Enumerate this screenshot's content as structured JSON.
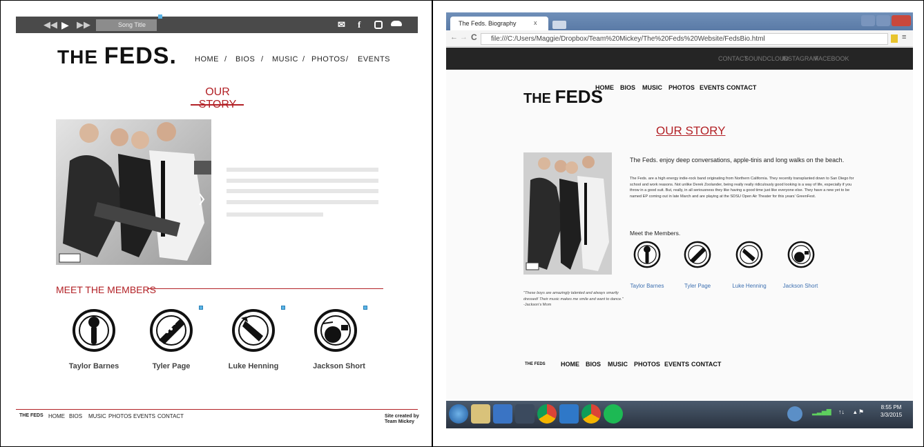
{
  "left": {
    "player": {
      "rewind": "◀◀",
      "play": "▶",
      "forward": "▶▶",
      "song_title": "Song Title",
      "icons": [
        "mail-icon",
        "facebook-icon",
        "instagram-icon",
        "soundcloud-icon"
      ]
    },
    "logo": {
      "the": "THE",
      "feds": "FEDS."
    },
    "nav": {
      "home": "HOME",
      "bios": "BIOS",
      "music": "MUSIC",
      "photos": "PHOTOS",
      "events": "EVENTS",
      "sep": "/"
    },
    "story_title": "OUR STORY",
    "meet_title": "MEET THE MEMBERS",
    "members": [
      "Taylor Barnes",
      "Tyler Page",
      "Luke Henning",
      "Jackson Short"
    ],
    "footer": {
      "logo": "THE FEDS",
      "links": [
        "HOME",
        "BIOS",
        "MUSIC",
        "PHOTOS",
        "EVENTS",
        "CONTACT"
      ],
      "credit_line1": "Site created by",
      "credit_line2": "Team Mickey"
    }
  },
  "right": {
    "tab_title": "The Feds. Biography",
    "tab_close": "x",
    "url": "file:///C:/Users/Maggie/Dropbox/Team%20Mickey/The%20Feds%20Website/FedsBio.html",
    "top_links": [
      "CONTACT",
      "SOUNDCLOUD",
      "INSTAGRAM",
      "FACEBOOK"
    ],
    "logo": {
      "the": "THE",
      "feds": "FEDS"
    },
    "nav": [
      "HOME",
      "BIOS",
      "MUSIC",
      "PHOTOS",
      "EVENTS",
      "CONTACT"
    ],
    "story_title": "OUR STORY",
    "tagline": "The Feds. enjoy deep conversations, apple-tinis and long walks on the beach.",
    "paragraph": "The Feds. are a high energy indie-rock band originating from Northern California. They recently transplanted down to San Diego for school and work reasons. Not unlike Derek Zoolander, being really really ridiculously good looking is a way of life, especially if you throw in a good suit. But, really, in all seriousness they like having a good time just like everyone else. They have a new yet to be named EP coming out in late March and are playing at the SDSU Open Air Theater for this years' GreenFest.",
    "meet_title": "Meet the Members.",
    "members": [
      "Taylor Barnes",
      "Tyler Page",
      "Luke Henning",
      "Jackson Short"
    ],
    "quote": "\"These boys are amazingly talented and always smartly dressed! Their music makes me smile and want to dance.\"",
    "quote_by": "-Jackson's Mom",
    "footer_logo": "THE FEDS",
    "footer_nav": [
      "HOME",
      "BIOS",
      "MUSIC",
      "PHOTOS",
      "EVENTS",
      "CONTACT"
    ],
    "clock_time": "8:55 PM",
    "clock_date": "3/3/2015"
  },
  "colors": {
    "accent": "#b22025",
    "link": "#3c6fb0",
    "player": "#4a4a4a",
    "sitenav": "#252525"
  }
}
